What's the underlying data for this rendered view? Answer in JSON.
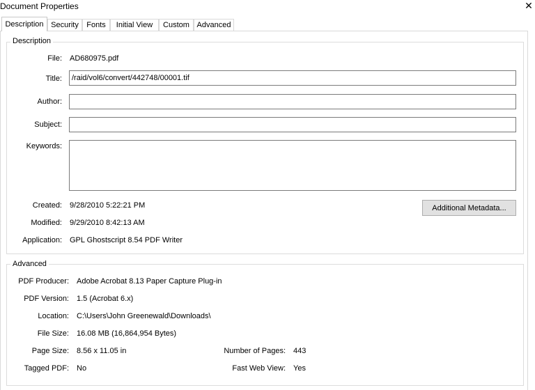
{
  "window": {
    "title": "Document Properties",
    "close_glyph": "✕"
  },
  "tabs": [
    "Description",
    "Security",
    "Fonts",
    "Initial View",
    "Custom",
    "Advanced"
  ],
  "description": {
    "legend": "Description",
    "file_label": "File:",
    "file_value": "AD680975.pdf",
    "title_label": "Title:",
    "title_value": "/raid/vol6/convert/442748/00001.tif",
    "author_label": "Author:",
    "author_value": "",
    "subject_label": "Subject:",
    "subject_value": "",
    "keywords_label": "Keywords:",
    "keywords_value": "",
    "created_label": "Created:",
    "created_value": "9/28/2010 5:22:21 PM",
    "modified_label": "Modified:",
    "modified_value": "9/29/2010 8:42:13 AM",
    "application_label": "Application:",
    "application_value": "GPL Ghostscript 8.54 PDF Writer",
    "metadata_button": "Additional Metadata..."
  },
  "advanced": {
    "legend": "Advanced",
    "producer_label": "PDF Producer:",
    "producer_value": "Adobe Acrobat 8.13 Paper Capture Plug-in",
    "version_label": "PDF Version:",
    "version_value": "1.5 (Acrobat 6.x)",
    "location_label": "Location:",
    "location_value": "C:\\Users\\John Greenewald\\Downloads\\",
    "filesize_label": "File Size:",
    "filesize_value": "16.08 MB (16,864,954 Bytes)",
    "pagesize_label": "Page Size:",
    "pagesize_value": "8.56 x 11.05 in",
    "numpages_label": "Number of Pages:",
    "numpages_value": "443",
    "tagged_label": "Tagged PDF:",
    "tagged_value": "No",
    "fastweb_label": "Fast Web View:",
    "fastweb_value": "Yes"
  }
}
